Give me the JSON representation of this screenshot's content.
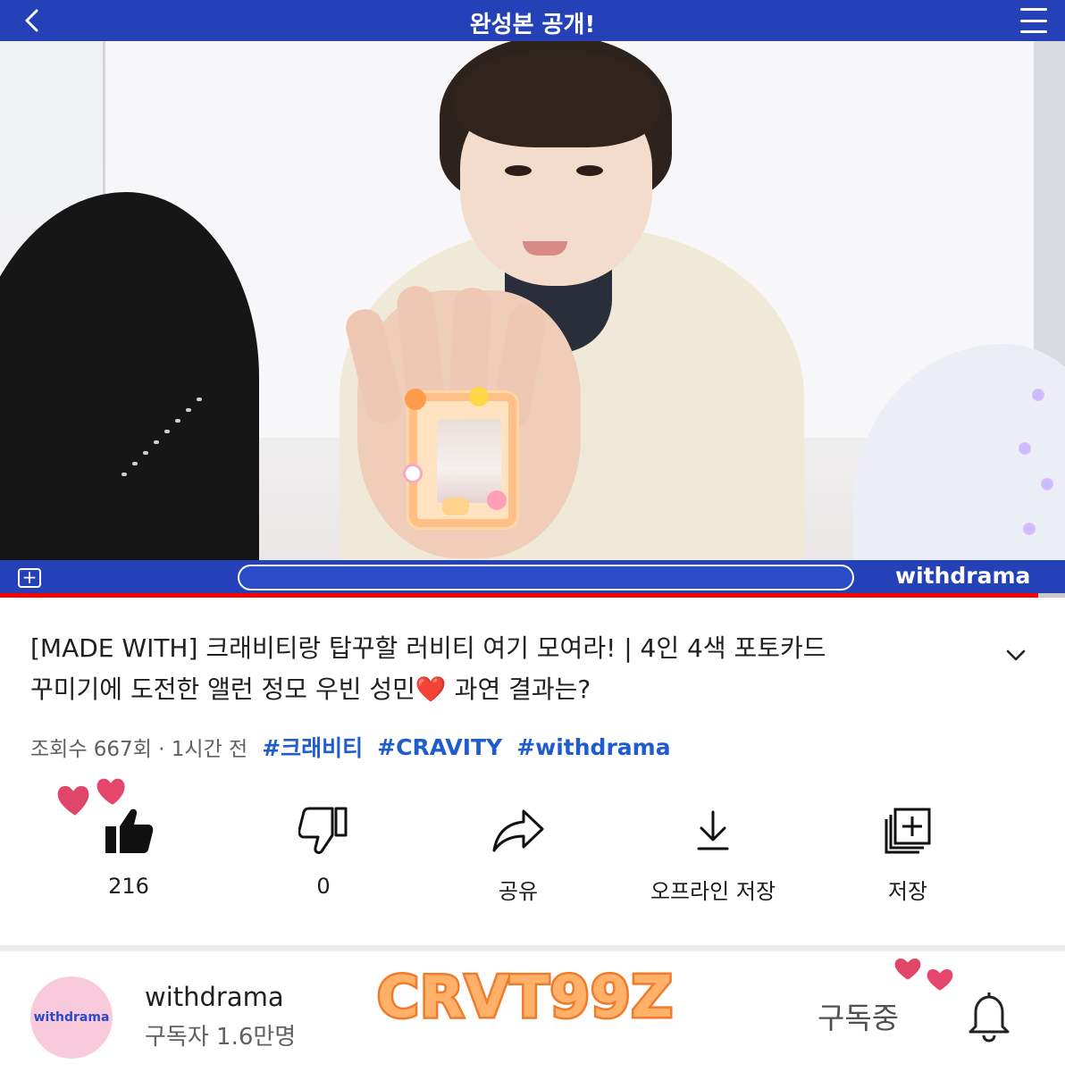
{
  "player": {
    "title": "완성본 공개!",
    "brand": "withdrama",
    "progress": 0.975
  },
  "video": {
    "title_part1": "[MADE WITH] 크래비티랑 탑꾸할 러비티 여기 모여라! | 4인 4색 포토카드",
    "title_part2": "꾸미기에 도전한 앨런 정모 우빈 성민",
    "title_heart": "❤️",
    "title_part3": " 과연 결과는?",
    "views": "조회수 667회 · 1시간 전",
    "hashtags": [
      "#크래비티",
      "#CRAVITY",
      "#withdrama"
    ]
  },
  "actions": {
    "like_count": "216",
    "dislike_count": "0",
    "share_label": "공유",
    "offline_label": "오프라인 저장",
    "save_label": "저장"
  },
  "channel": {
    "avatar_text": "withdrama",
    "name": "withdrama",
    "subscribers": "구독자 1.6만명",
    "subscribed_label": "구독중"
  },
  "watermark": "CRVT99Z",
  "colors": {
    "player_bar": "#2441b8",
    "progress": "#ff0000",
    "hashtag": "#1f5ccf",
    "heart": "#e0456a",
    "watermark": "#ffb169"
  },
  "icons": [
    "back-icon",
    "menu-icon",
    "add-icon",
    "chevron-down-icon",
    "like-icon",
    "dislike-icon",
    "share-icon",
    "download-icon",
    "save-playlist-icon",
    "bell-icon",
    "heart-sticker"
  ]
}
